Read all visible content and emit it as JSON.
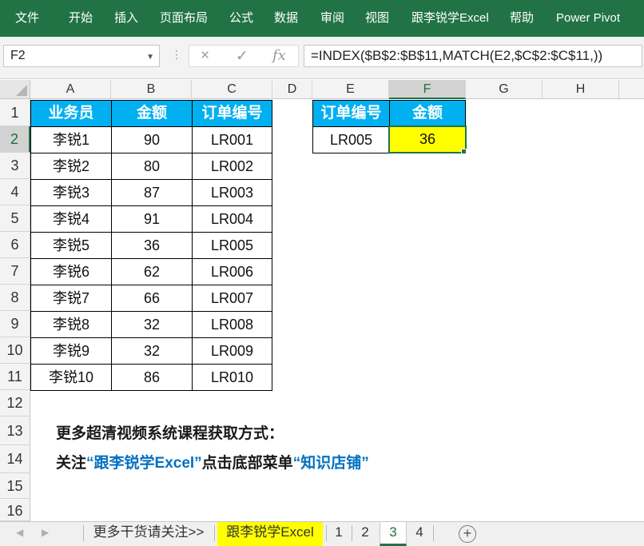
{
  "ribbon": {
    "tabs": [
      "文件",
      "开始",
      "插入",
      "页面布局",
      "公式",
      "数据",
      "审阅",
      "视图",
      "跟李锐学Excel",
      "帮助",
      "Power Pivot"
    ]
  },
  "formula_bar": {
    "name_box": "F2",
    "formula": "=INDEX($B$2:$B$11,MATCH(E2,$C$2:$C$11,))",
    "cancel_icon": "×",
    "enter_icon": "✓",
    "fx_label": "fx"
  },
  "columns": [
    "A",
    "B",
    "C",
    "D",
    "E",
    "F",
    "G",
    "H"
  ],
  "rows": [
    "1",
    "2",
    "3",
    "4",
    "5",
    "6",
    "7",
    "8",
    "9",
    "10",
    "11",
    "12",
    "13",
    "14",
    "15",
    "16"
  ],
  "table": {
    "headers": [
      "业务员",
      "金额",
      "订单编号"
    ],
    "rows": [
      [
        "李锐1",
        "90",
        "LR001"
      ],
      [
        "李锐2",
        "80",
        "LR002"
      ],
      [
        "李锐3",
        "87",
        "LR003"
      ],
      [
        "李锐4",
        "91",
        "LR004"
      ],
      [
        "李锐5",
        "36",
        "LR005"
      ],
      [
        "李锐6",
        "62",
        "LR006"
      ],
      [
        "李锐7",
        "66",
        "LR007"
      ],
      [
        "李锐8",
        "32",
        "LR008"
      ],
      [
        "李锐9",
        "32",
        "LR009"
      ],
      [
        "李锐10",
        "86",
        "LR010"
      ]
    ]
  },
  "lookup": {
    "headers": [
      "订单编号",
      "金额"
    ],
    "order_id": "LR005",
    "result": "36"
  },
  "notes": {
    "line1": "更多超清视频系统课程获取方式：",
    "line2_a": "关注",
    "line2_b": "“跟李锐学Excel”",
    "line2_c": "点击底部菜单",
    "line2_d": "“知识店铺”"
  },
  "sheet_tabs": {
    "nav_prev": "◀",
    "nav_next": "▶",
    "items": [
      "更多干货请关注>>",
      "跟李锐学Excel",
      "1",
      "2",
      "3",
      "4"
    ],
    "active": "3",
    "add": "+"
  },
  "colors": {
    "ribbon": "#217346",
    "header_fill": "#00b0f0",
    "result_fill": "#ffff00",
    "accent_text": "#0070c0"
  }
}
